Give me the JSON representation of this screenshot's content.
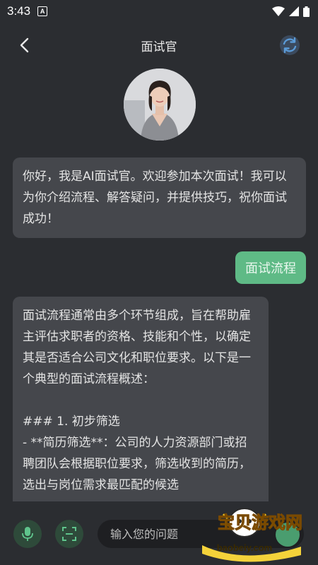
{
  "status_bar": {
    "time": "3:43",
    "notif_letter": "A"
  },
  "header": {
    "title": "面试官"
  },
  "chat": {
    "greeting": "你好，我是AI面试官。欢迎参加本次面试！我可以为你介绍流程、解答疑问，并提供技巧，祝你面试成功！",
    "user_message": "面试流程",
    "reply": "面试流程通常由多个环节组成，旨在帮助雇主评估求职者的资格、技能和个性，以确定其是否适合公司文化和职位要求。以下是一个典型的面试流程概述：\n\n### 1. 初步筛选\n- **简历筛选**：公司的人力资源部门或招聘团队会根据职位要求，筛选收到的简历，选出与岗位需求最匹配的候选"
  },
  "input": {
    "placeholder": "输入您的问题"
  },
  "watermark": {
    "title": "宝贝游戏网",
    "url": "baobeiy.com"
  },
  "colors": {
    "background": "#2b2d31",
    "bubble_ai": "#45474c",
    "bubble_user": "#5fba86",
    "accent": "#4fae7a"
  },
  "icons": [
    "back-arrow-icon",
    "refresh-icon",
    "mic-icon",
    "scan-icon",
    "wifi-icon",
    "signal-icon",
    "battery-icon"
  ]
}
